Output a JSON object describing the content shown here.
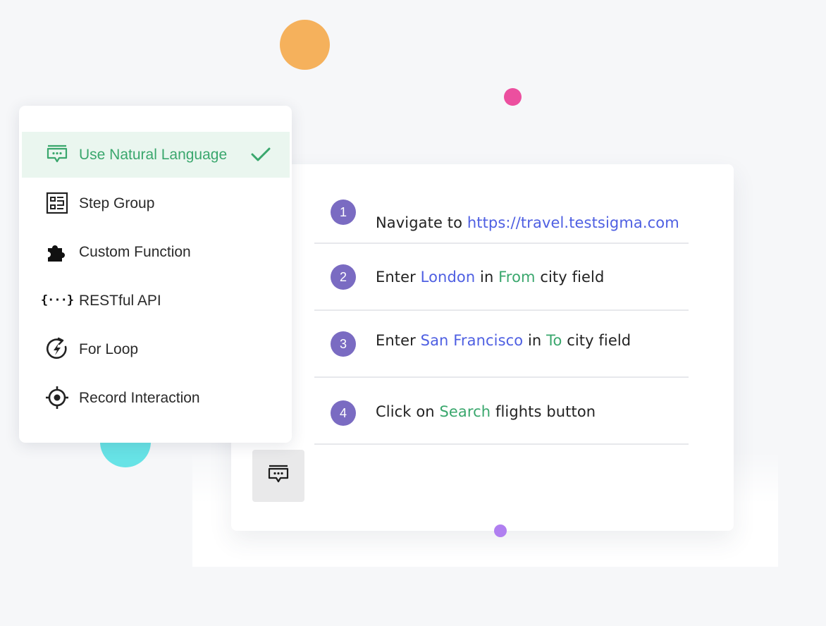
{
  "menu": {
    "items": [
      {
        "label": "Use Natural Language",
        "icon": "chat-icon",
        "selected": true
      },
      {
        "label": "Step Group",
        "icon": "step-group-icon",
        "selected": false
      },
      {
        "label": "Custom Function",
        "icon": "puzzle-icon",
        "selected": false
      },
      {
        "label": "RESTful API",
        "icon": "braces-icon",
        "selected": false,
        "icon_text": "{···}"
      },
      {
        "label": "For Loop",
        "icon": "loop-icon",
        "selected": false
      },
      {
        "label": "Record Interaction",
        "icon": "crosshair-icon",
        "selected": false
      }
    ]
  },
  "steps": [
    {
      "number": "1",
      "parts": [
        "Navigate to ",
        "https://travel.testsigma.com"
      ]
    },
    {
      "number": "2",
      "parts": [
        "Enter ",
        "London",
        " in ",
        "From",
        " city field"
      ]
    },
    {
      "number": "3",
      "parts": [
        "Enter ",
        "San Francisco",
        " in ",
        "To",
        " city field"
      ]
    },
    {
      "number": "4",
      "parts": [
        "Click on ",
        "Search",
        " flights button"
      ]
    }
  ],
  "colors": {
    "accent_green": "#3aa76d",
    "link_blue": "#4e5fe2",
    "step_badge": "#7a6bc2",
    "dot_orange": "#f5b15c",
    "dot_pink": "#ec4f9f",
    "dot_cyan": "#67e3e6",
    "dot_purple": "#b07ff0"
  }
}
